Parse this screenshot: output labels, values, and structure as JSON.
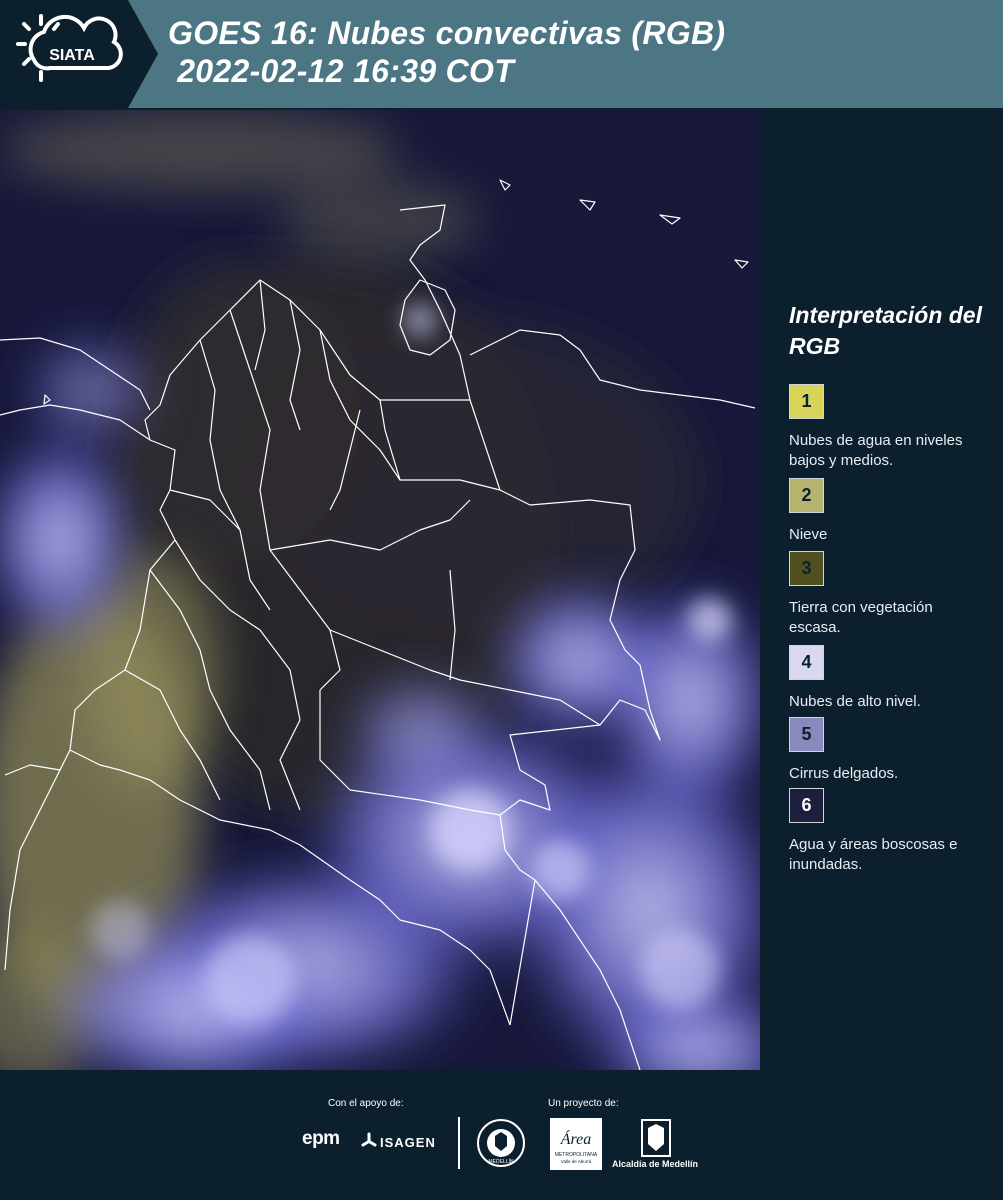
{
  "header": {
    "logo_text": "SIATA",
    "title": "GOES 16: Nubes convectivas (RGB)\n 2022-02-12 16:39 COT"
  },
  "map": {
    "product": "Nubes convectivas (RGB)"
  },
  "legend": {
    "title": "Interpretación del RGB",
    "items": [
      {
        "number": "1",
        "label": "Nubes de agua en niveles bajos y medios.",
        "color": "#d8d45a"
      },
      {
        "number": "2",
        "label": "Nieve",
        "color": "#b7b36e"
      },
      {
        "number": "3",
        "label": "Tierra con vegetación escasa.",
        "color": "#4f4f20"
      },
      {
        "number": "4",
        "label": "Nubes de alto nivel.",
        "color": "#d9d8f1"
      },
      {
        "number": "5",
        "label": "Cirrus delgados.",
        "color": "#8a88bd"
      },
      {
        "number": "6",
        "label": "Agua y áreas boscosas e inundadas.",
        "color": "#1e1f3c"
      }
    ]
  },
  "footer": {
    "support_label": "Con el apoyo de:",
    "project_label": "Un proyecto de:",
    "sponsors": [
      "epm",
      "ISAGEN"
    ],
    "partners": [
      "Medellín",
      "Área Metropolitana Valle de Aburrá",
      "Alcaldía de Medellín"
    ],
    "epm_text": "epm",
    "isagen_text": "ISAGEN",
    "area_text": "Área",
    "area_sub": "METROPOLITANA",
    "area_sub2": "Valle de Aburrá",
    "alcaldia_text": "Alcaldía de Medellín",
    "medellin_seal_text": "MEDELLÍN"
  }
}
